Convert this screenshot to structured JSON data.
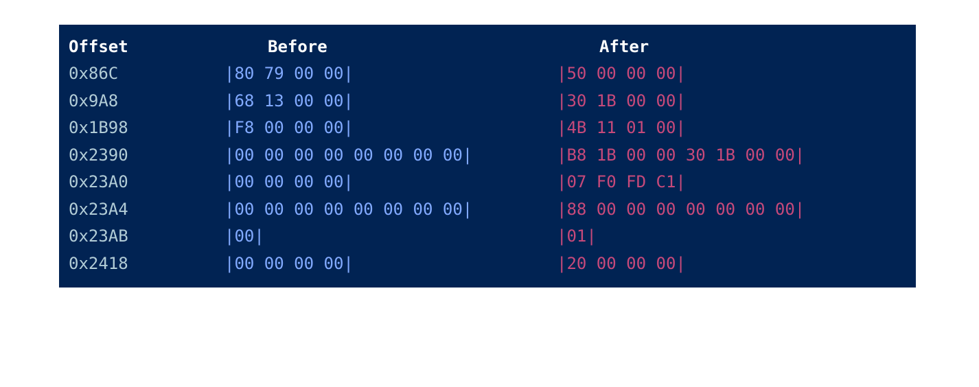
{
  "headers": {
    "offset": "Offset",
    "before": "Before",
    "after": "After"
  },
  "rows": [
    {
      "offset": "0x86C",
      "before": "|80 79 00 00|",
      "after": "|50 00 00 00|"
    },
    {
      "offset": "0x9A8",
      "before": "|68 13 00 00|",
      "after": "|30 1B 00 00|"
    },
    {
      "offset": "0x1B98",
      "before": "|F8 00 00 00|",
      "after": "|4B 11 01 00|"
    },
    {
      "offset": "0x2390",
      "before": "|00 00 00 00 00 00 00 00|",
      "after": "|B8 1B 00 00 30 1B 00 00|"
    },
    {
      "offset": "0x23A0",
      "before": "|00 00 00 00|",
      "after": "|07 F0 FD C1|"
    },
    {
      "offset": "0x23A4",
      "before": "|00 00 00 00 00 00 00 00|",
      "after": "|88 00 00 00 00 00 00 00|"
    },
    {
      "offset": "0x23AB",
      "before": "|00|",
      "after": "|01|"
    },
    {
      "offset": "0x2418",
      "before": "|00 00 00 00|",
      "after": "|20 00 00 00|"
    }
  ],
  "colors": {
    "background": "#012353",
    "header": "#ffffff",
    "offset": "#b2ccd6",
    "before": "#82aaff",
    "after": "#c7497a"
  }
}
